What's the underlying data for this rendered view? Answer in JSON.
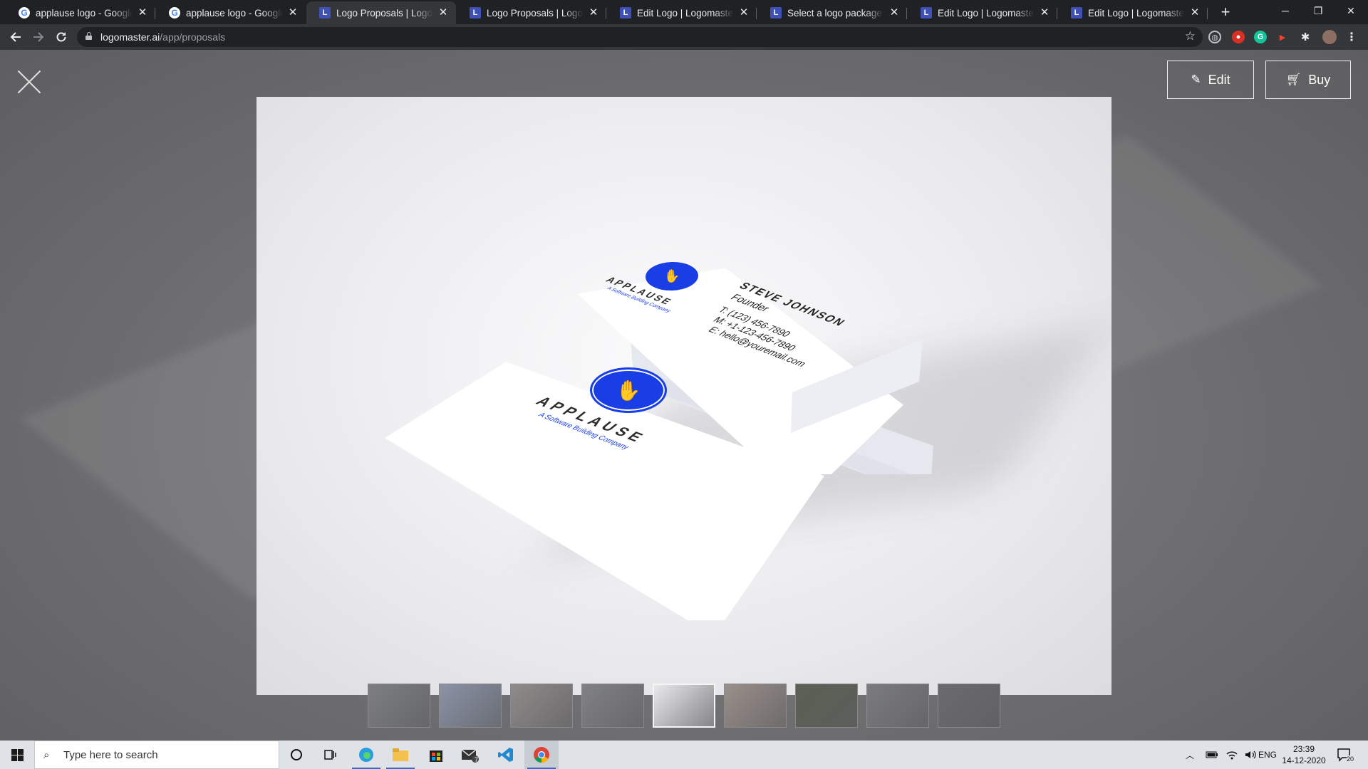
{
  "browser": {
    "tabs": [
      {
        "favicon": "google-icon",
        "title": "applause logo - Google Search",
        "active": false
      },
      {
        "favicon": "google-icon",
        "title": "applause logo - Google Search",
        "active": false
      },
      {
        "favicon": "logomaster-icon",
        "title": "Logo Proposals | Logomaster.ai",
        "active": true
      },
      {
        "favicon": "logomaster-icon",
        "title": "Logo Proposals | Logomaster.ai",
        "active": false
      },
      {
        "favicon": "logomaster-icon",
        "title": "Edit Logo | Logomaster: Online",
        "active": false
      },
      {
        "favicon": "logomaster-icon",
        "title": "Select a logo package | Logomaster",
        "active": false
      },
      {
        "favicon": "logomaster-icon",
        "title": "Edit Logo | Logomaster: Online",
        "active": false
      },
      {
        "favicon": "logomaster-icon",
        "title": "Edit Logo | Logomaster: Online",
        "active": false
      }
    ],
    "url_host": "logomaster.ai",
    "url_path": "/app/proposals",
    "tab_glyph_letter": "L",
    "close_glyph": "✕",
    "new_tab_glyph": "+",
    "window_controls": {
      "minimize": "─",
      "restore": "❐",
      "close": "✕"
    }
  },
  "modal": {
    "edit_label": "Edit",
    "buy_label": "Buy",
    "mockup": {
      "brand_name": "APPLAUSE",
      "tagline": "A Software Building Company",
      "person_name": "STEVE JOHNSON",
      "person_title": "Founder",
      "phone": "T: (123) 456-7890",
      "mobile": "M: +1-123-456-7890",
      "email": "E: hello@youremail.com",
      "brand_color": "#1a3ee6"
    },
    "thumbnails": [
      {
        "name": "sign-mockup",
        "color": "#7d7f82"
      },
      {
        "name": "phone-mockup",
        "color": "#8b93a6"
      },
      {
        "name": "hand-mockup",
        "color": "#8f8b8a"
      },
      {
        "name": "bag-mockup",
        "color": "#818285"
      },
      {
        "name": "business-card-mockup",
        "color": "#e9e9ec",
        "active": true
      },
      {
        "name": "stationery-mockup",
        "color": "#9a8f8a"
      },
      {
        "name": "storefront-mockup",
        "color": "#5a6052"
      },
      {
        "name": "tshirt-mockup",
        "color": "#7b7c7f"
      },
      {
        "name": "dark-mockup",
        "color": "#6b6b6d"
      }
    ]
  },
  "taskbar": {
    "search_placeholder": "Type here to search",
    "mail_badge": "7",
    "language": "ENG",
    "time": "23:39",
    "date": "14-12-2020",
    "notification_count": "20"
  }
}
